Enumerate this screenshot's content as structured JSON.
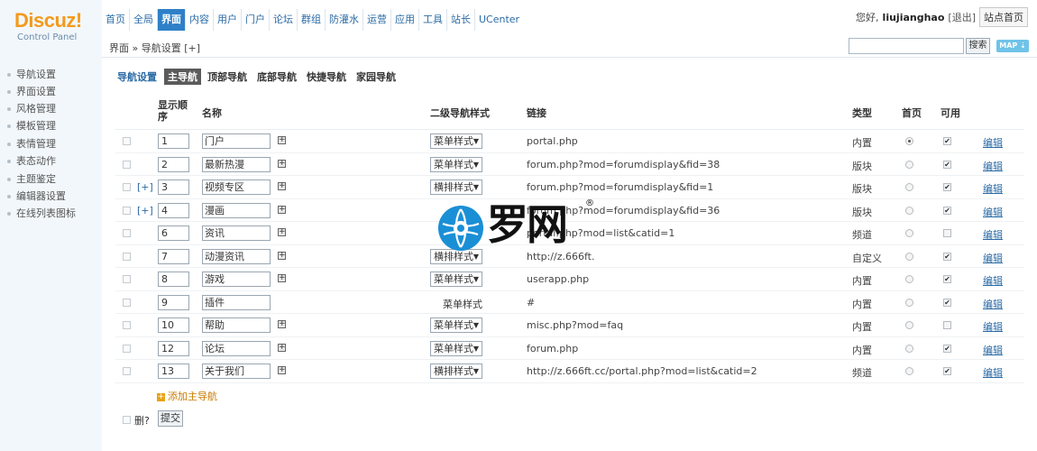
{
  "logo": {
    "main": "Discuz!",
    "sub": "Control Panel"
  },
  "topnav": [
    "首页",
    "全局",
    "界面",
    "内容",
    "用户",
    "门户",
    "论坛",
    "群组",
    "防灌水",
    "运营",
    "应用",
    "工具",
    "站长",
    "UCenter"
  ],
  "topnav_active": "界面",
  "user": {
    "greeting": "您好,",
    "name": "liujianghao",
    "logout": "[退出]",
    "site_home": "站点首页"
  },
  "breadcrumb": "界面 » 导航设置 [+]",
  "search": {
    "button": "搜索",
    "map_label": "MAP"
  },
  "sidebar": [
    "导航设置",
    "界面设置",
    "风格管理",
    "模板管理",
    "表情管理",
    "表态动作",
    "主题鉴定",
    "编辑器设置",
    "在线列表图标"
  ],
  "subtabs": {
    "title": "导航设置",
    "items": [
      "主导航",
      "顶部导航",
      "底部导航",
      "快捷导航",
      "家园导航"
    ],
    "active": "主导航"
  },
  "columns": {
    "order": "显示顺序",
    "name": "名称",
    "style": "二级导航样式",
    "link": "链接",
    "type": "类型",
    "home": "首页",
    "enabled": "可用"
  },
  "rows": [
    {
      "expand": "",
      "order": "1",
      "name": "门户",
      "plus": true,
      "style": "菜单样式",
      "style_select": true,
      "link": "portal.php",
      "type": "内置",
      "home": true,
      "enabled": true,
      "edit": "编辑"
    },
    {
      "expand": "",
      "order": "2",
      "name": "最新热漫",
      "plus": true,
      "style": "菜单样式",
      "style_select": true,
      "link": "forum.php?mod=forumdisplay&fid=38",
      "type": "版块",
      "home": false,
      "enabled": true,
      "edit": "编辑"
    },
    {
      "expand": "[+]",
      "order": "3",
      "name": "视频专区",
      "plus": true,
      "style": "横排样式",
      "style_select": true,
      "link": "forum.php?mod=forumdisplay&fid=1",
      "type": "版块",
      "home": false,
      "enabled": true,
      "edit": "编辑"
    },
    {
      "expand": "[+]",
      "order": "4",
      "name": "漫画",
      "plus": true,
      "style": "",
      "style_select": false,
      "link": "forum.php?mod=forumdisplay&fid=36",
      "type": "版块",
      "home": false,
      "enabled": true,
      "edit": "编辑"
    },
    {
      "expand": "",
      "order": "6",
      "name": "资讯",
      "plus": true,
      "style": "",
      "style_select": false,
      "link": "portal.php?mod=list&catid=1",
      "type": "频道",
      "home": false,
      "enabled": false,
      "edit": "编辑"
    },
    {
      "expand": "",
      "order": "7",
      "name": "动漫资讯",
      "plus": true,
      "style": "横排样式",
      "style_select": true,
      "link": "http://z.666ft.",
      "type": "自定义",
      "home": false,
      "enabled": true,
      "edit": "编辑"
    },
    {
      "expand": "",
      "order": "8",
      "name": "游戏",
      "plus": true,
      "style": "菜单样式",
      "style_select": true,
      "link": "userapp.php",
      "type": "内置",
      "home": false,
      "enabled": true,
      "edit": "编辑"
    },
    {
      "expand": "",
      "order": "9",
      "name": "插件",
      "plus": false,
      "style": "菜单样式",
      "style_select": false,
      "link": "#",
      "type": "内置",
      "home": false,
      "enabled": true,
      "edit": "编辑"
    },
    {
      "expand": "",
      "order": "10",
      "name": "帮助",
      "plus": true,
      "style": "菜单样式",
      "style_select": true,
      "link": "misc.php?mod=faq",
      "type": "内置",
      "home": false,
      "enabled": false,
      "edit": "编辑"
    },
    {
      "expand": "",
      "order": "12",
      "name": "论坛",
      "plus": true,
      "style": "菜单样式",
      "style_select": true,
      "link": "forum.php",
      "type": "内置",
      "home": false,
      "enabled": true,
      "edit": "编辑"
    },
    {
      "expand": "",
      "order": "13",
      "name": "关于我们",
      "plus": true,
      "style": "横排样式",
      "style_select": true,
      "link": "http://z.666ft.cc/portal.php?mod=list&catid=2",
      "type": "频道",
      "home": false,
      "enabled": true,
      "edit": "编辑"
    }
  ],
  "add_main_nav": "添加主导航",
  "footer": {
    "delete_label": "删?",
    "submit": "提交"
  },
  "watermark": {
    "text": "罗网",
    "reg": "®"
  },
  "colors": {
    "accent": "#2e80c8",
    "link": "#2b6ba5",
    "sidebar_bg": "#f2f7fb",
    "logo_orange": "#f39a1c",
    "watermark_blue": "#1b8fd6"
  }
}
